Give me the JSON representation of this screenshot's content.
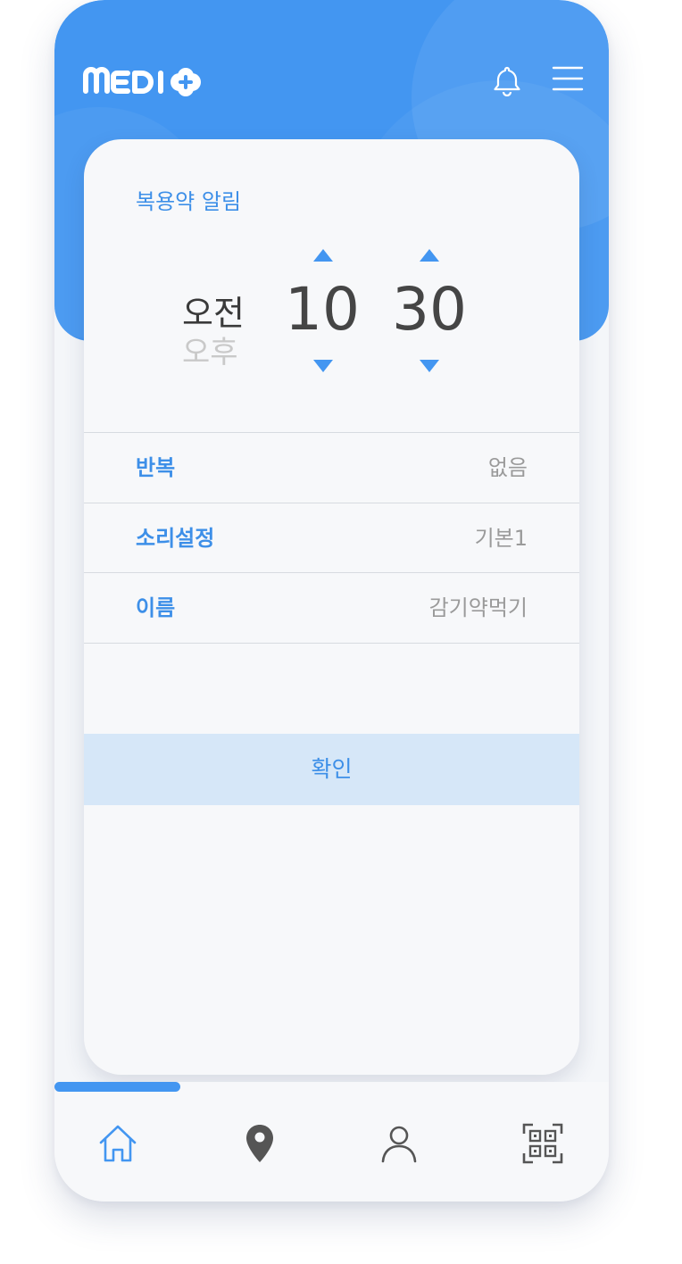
{
  "app": {
    "logo_text": "MEDI+",
    "accent_color": "#4396f1",
    "header_icons": [
      "bell-icon",
      "menu-icon"
    ]
  },
  "alarm": {
    "title": "복용약 알림",
    "period_selected": "오전",
    "period_other": "오후",
    "hour": "10",
    "minute": "30",
    "controls": [
      "hour-up",
      "hour-down",
      "minute-up",
      "minute-down"
    ]
  },
  "settings": [
    {
      "label": "반복",
      "value": "없음"
    },
    {
      "label": "소리설정",
      "value": "기본1"
    },
    {
      "label": "이름",
      "value": "감기약먹기"
    }
  ],
  "confirm_label": "확인",
  "tabbar": {
    "items": [
      "home-icon",
      "location-pin-icon",
      "profile-icon",
      "qr-code-icon"
    ],
    "active": "home-icon",
    "active_color": "#4396f1",
    "inactive_color": "#555555"
  }
}
